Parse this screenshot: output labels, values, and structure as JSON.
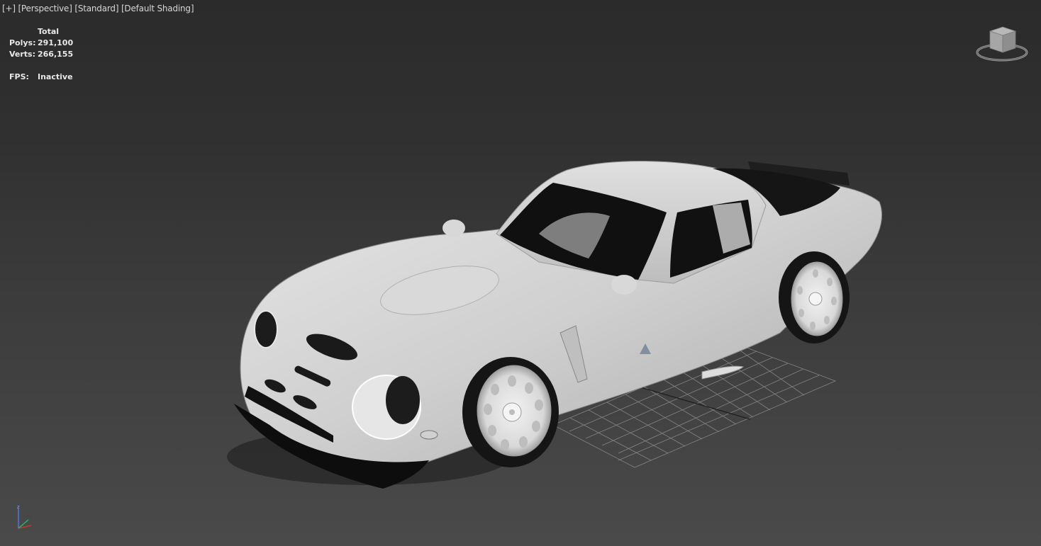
{
  "viewport": {
    "menu_label": "[+]",
    "view_label": "[Perspective]",
    "mode_label": "[Standard]",
    "shading_label": "[Default Shading]"
  },
  "stats": {
    "header": "Total",
    "polys_label": "Polys:",
    "polys_value": "291,100",
    "verts_label": "Verts:",
    "verts_value": "266,155",
    "fps_label": "FPS:",
    "fps_value": "Inactive"
  },
  "icons": {
    "viewcube": "viewcube-icon",
    "axis": "axis-tripod-icon"
  },
  "colors": {
    "background_top": "#2b2b2b",
    "background_bottom": "#4a4a4a",
    "model": "#cfcfcf",
    "grid": "#8a8a8a",
    "axis_x": "#c0392b",
    "axis_y": "#27ae60",
    "axis_z": "#4a7bd4"
  }
}
